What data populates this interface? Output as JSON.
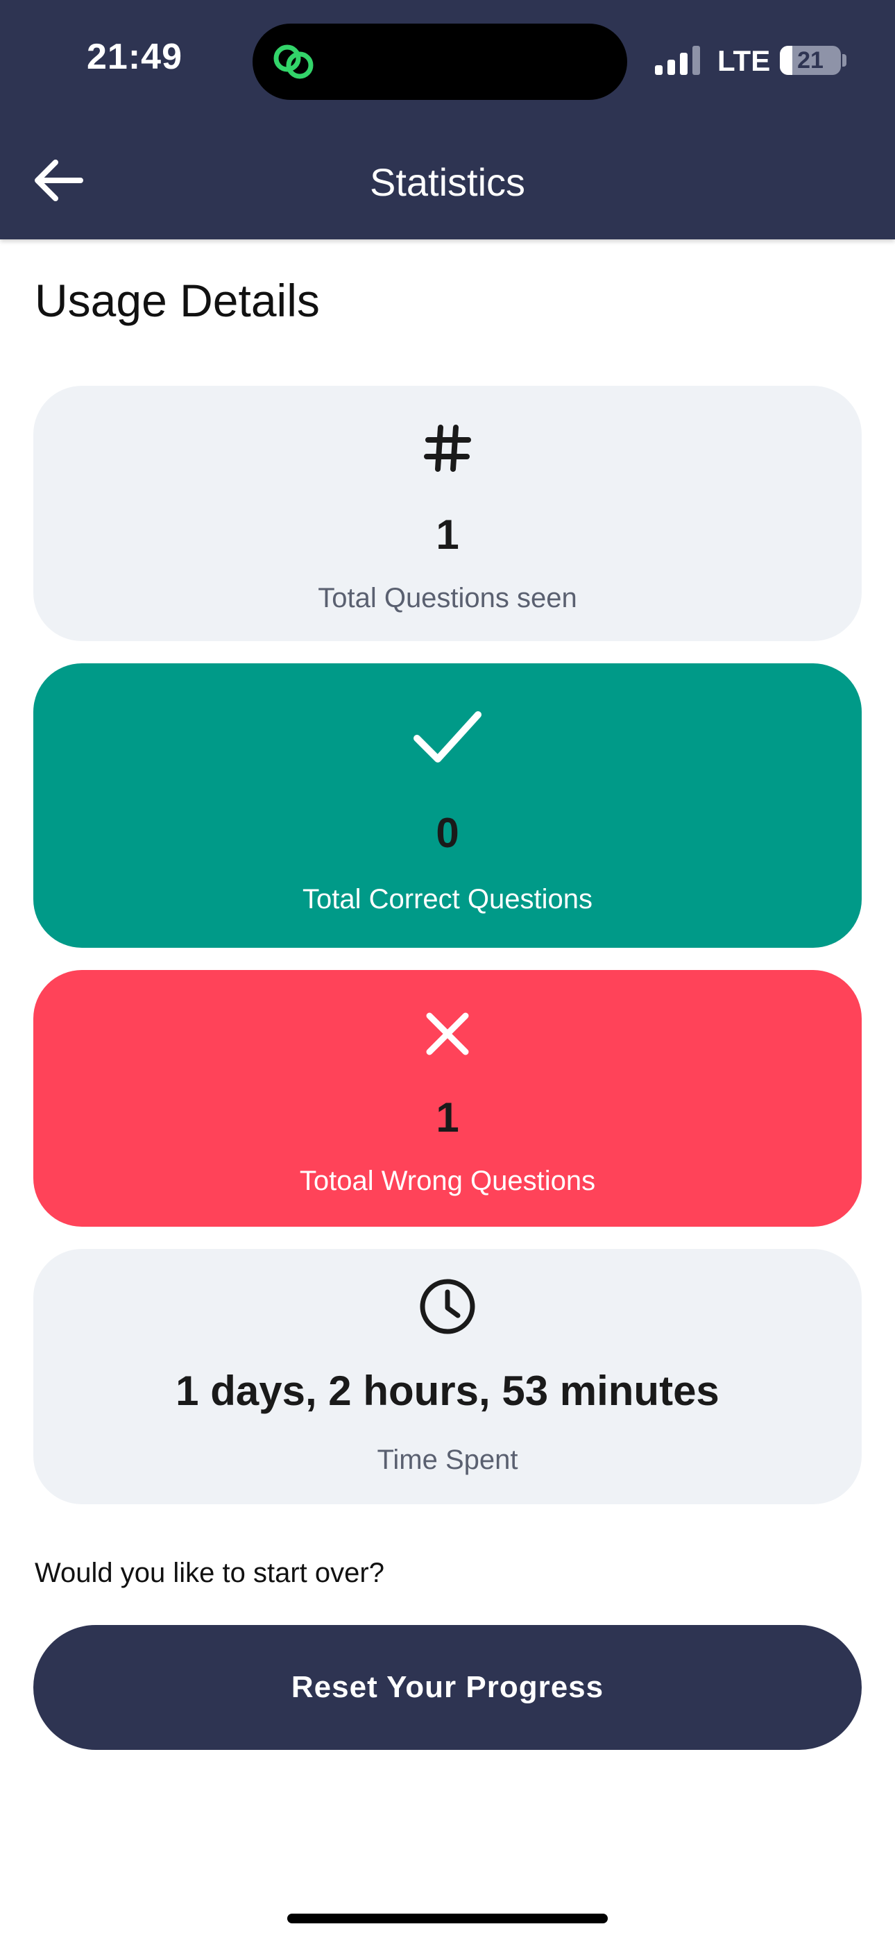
{
  "status_bar": {
    "time": "21:49",
    "network": "LTE",
    "battery_level": "21",
    "battery_percent": 21
  },
  "header": {
    "title": "Statistics",
    "back_icon": "arrow-left-icon"
  },
  "section_title": "Usage Details",
  "cards": [
    {
      "icon": "hash-icon",
      "value": "1",
      "label": "Total Questions seen"
    },
    {
      "icon": "check-icon",
      "value": "0",
      "label": "Total Correct Questions"
    },
    {
      "icon": "close-icon",
      "value": "1",
      "label": "Totoal Wrong Questions"
    },
    {
      "icon": "clock-icon",
      "value": "1 days, 2 hours, 53 minutes",
      "label": "Time Spent"
    }
  ],
  "reset": {
    "prompt": "Would you like to start over?",
    "button_label": "Reset Your Progress"
  },
  "colors": {
    "header_bg": "#2e3452",
    "correct_card": "#009a88",
    "wrong_card": "#ff4359",
    "neutral_card": "#eff2f6",
    "chat_icon": "#33d46a"
  }
}
